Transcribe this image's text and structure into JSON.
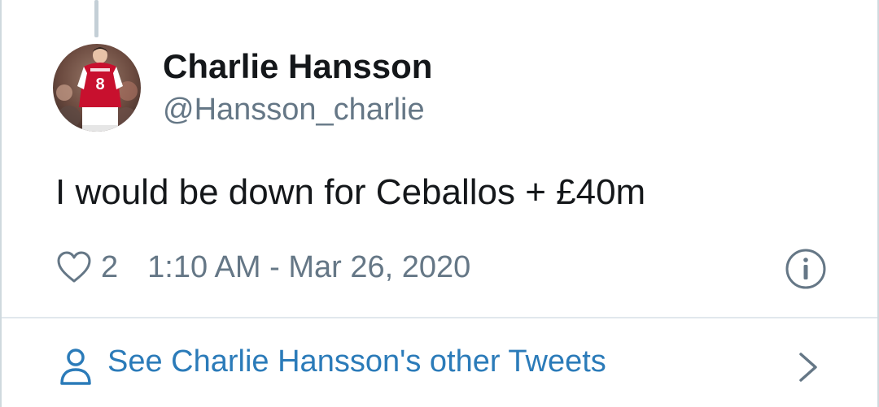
{
  "tweet": {
    "author_name": "Charlie Hansson",
    "author_handle": "@Hansson_charlie",
    "text": "I would be down for Ceballos + £40m",
    "like_count": "2",
    "timestamp": "1:10 AM - Mar 26, 2020",
    "avatar_jersey_number": "8"
  },
  "footer": {
    "other_tweets_label": "See Charlie Hansson's other Tweets"
  },
  "icons": {
    "like": "heart-icon",
    "info": "info-circle-icon",
    "profile": "person-icon",
    "more": "chevron-right-icon"
  },
  "colors": {
    "name": "#14171a",
    "secondary_text": "#657786",
    "link": "#2b7bb9",
    "border": "#cfd9de",
    "divider": "#e1e8ed",
    "thread_line": "#c4cfd6"
  }
}
